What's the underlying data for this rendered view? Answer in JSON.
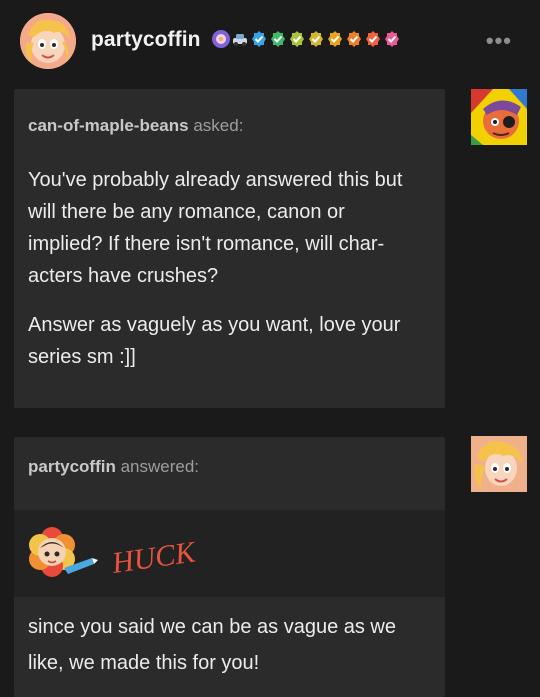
{
  "header": {
    "username": "partycoffin",
    "more_label": "•••",
    "badge_colors": [
      "#e06bd4",
      "#36a3e8",
      "#3fb86a",
      "#a7c43c",
      "#d4b72b",
      "#e8a31d",
      "#ee7f26",
      "#f0623e",
      "#ec5a93"
    ]
  },
  "ask": {
    "asker_name": "can-of-maple-beans",
    "asker_suffix": "asked:",
    "paragraph1": "You've probably already answered this but will there be any romance, canon or implied? If there isn't romance, will char-acters have crushes?",
    "paragraph2": "Answer as vaguely as you want, love your series sm :]]"
  },
  "answer": {
    "answerer_name": "partycoffin",
    "answerer_suffix": "answered:",
    "image_caption": "HUCK",
    "text": "since you said we can be as vague as we like, we made this for you!"
  }
}
